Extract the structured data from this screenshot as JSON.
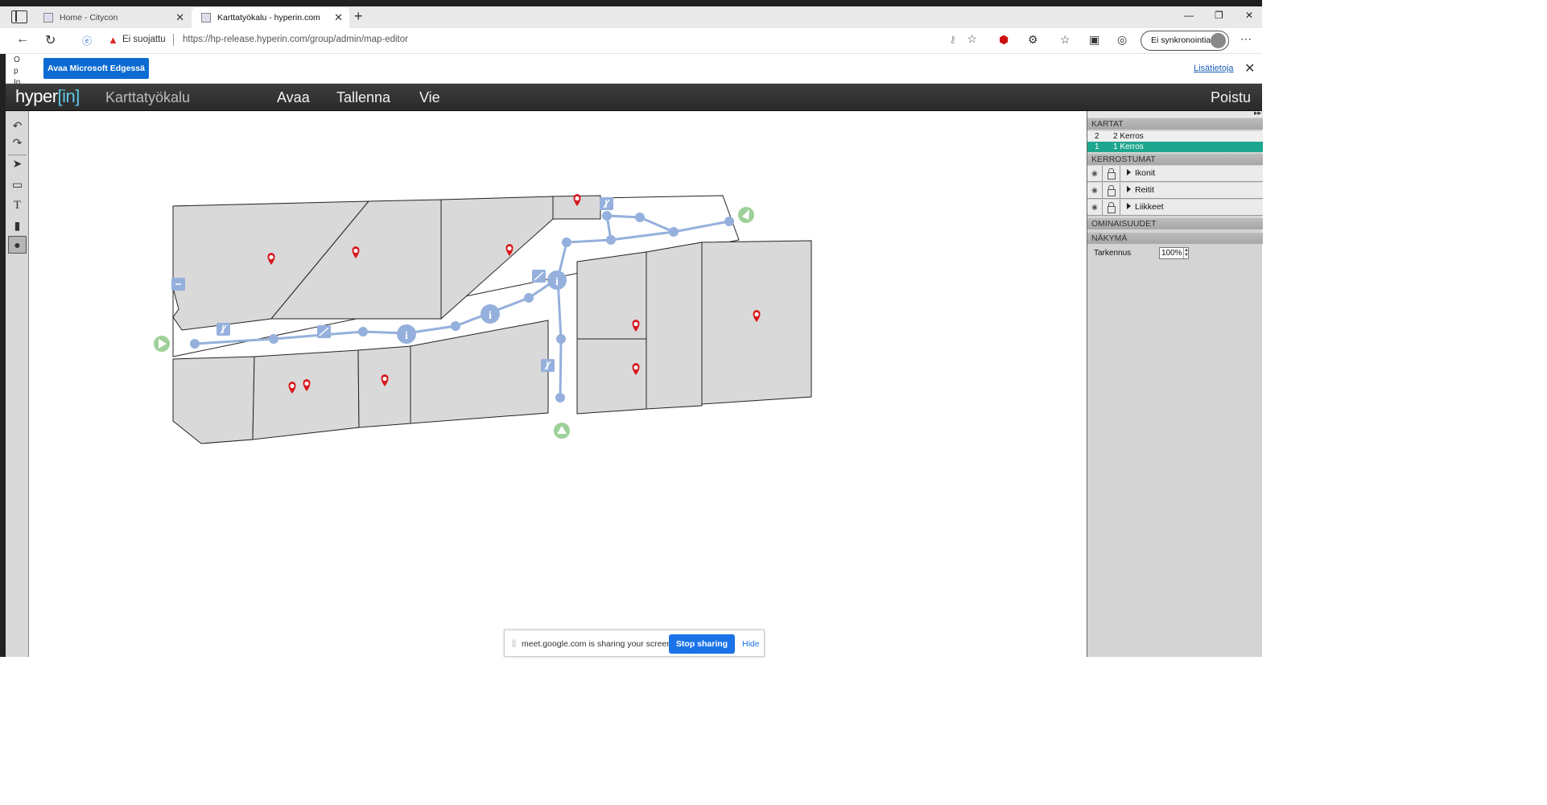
{
  "browser": {
    "tabs": [
      {
        "title": "Home - Citycon",
        "active": false
      },
      {
        "title": "Karttatyökalu - hyperin.com",
        "active": true
      }
    ],
    "security_label": "Ei suojattu",
    "url": "https://hp-release.hyperin.com/group/admin/map-editor",
    "profile_label": "Ei synkronointia"
  },
  "infobar": {
    "side_text": "O p In",
    "open_button": "Avaa Microsoft Edgessä",
    "more_info": "Lisätietoja"
  },
  "app": {
    "logo_main": "hyper",
    "logo_bracket": "[in]",
    "title": "Karttatyökalu",
    "menu": [
      "Avaa",
      "Tallenna",
      "Vie"
    ],
    "logout": "Poistu"
  },
  "panel": {
    "maps_header": "KARTAT",
    "maps": [
      {
        "num": "2",
        "name": "2 Kerros",
        "selected": false
      },
      {
        "num": "1",
        "name": "1 Kerros",
        "selected": true
      }
    ],
    "layers_header": "KERROSTUMAT",
    "layers": [
      "Ikonit",
      "Reitit",
      "Liikkeet"
    ],
    "properties_header": "OMINAISUUDET",
    "view_header": "NÄKYMÄ",
    "zoom_label": "Tarkennus",
    "zoom_value": "100%"
  },
  "sharebar": {
    "message": "meet.google.com is sharing your screen.",
    "stop": "Stop sharing",
    "hide": "Hide"
  },
  "colors": {
    "selected_map": "#1fa68e",
    "route": "#95b0dc",
    "poi_pin": "#d7191e",
    "entrance": "#9ed19a",
    "shop_fill": "#d9d9d9"
  }
}
